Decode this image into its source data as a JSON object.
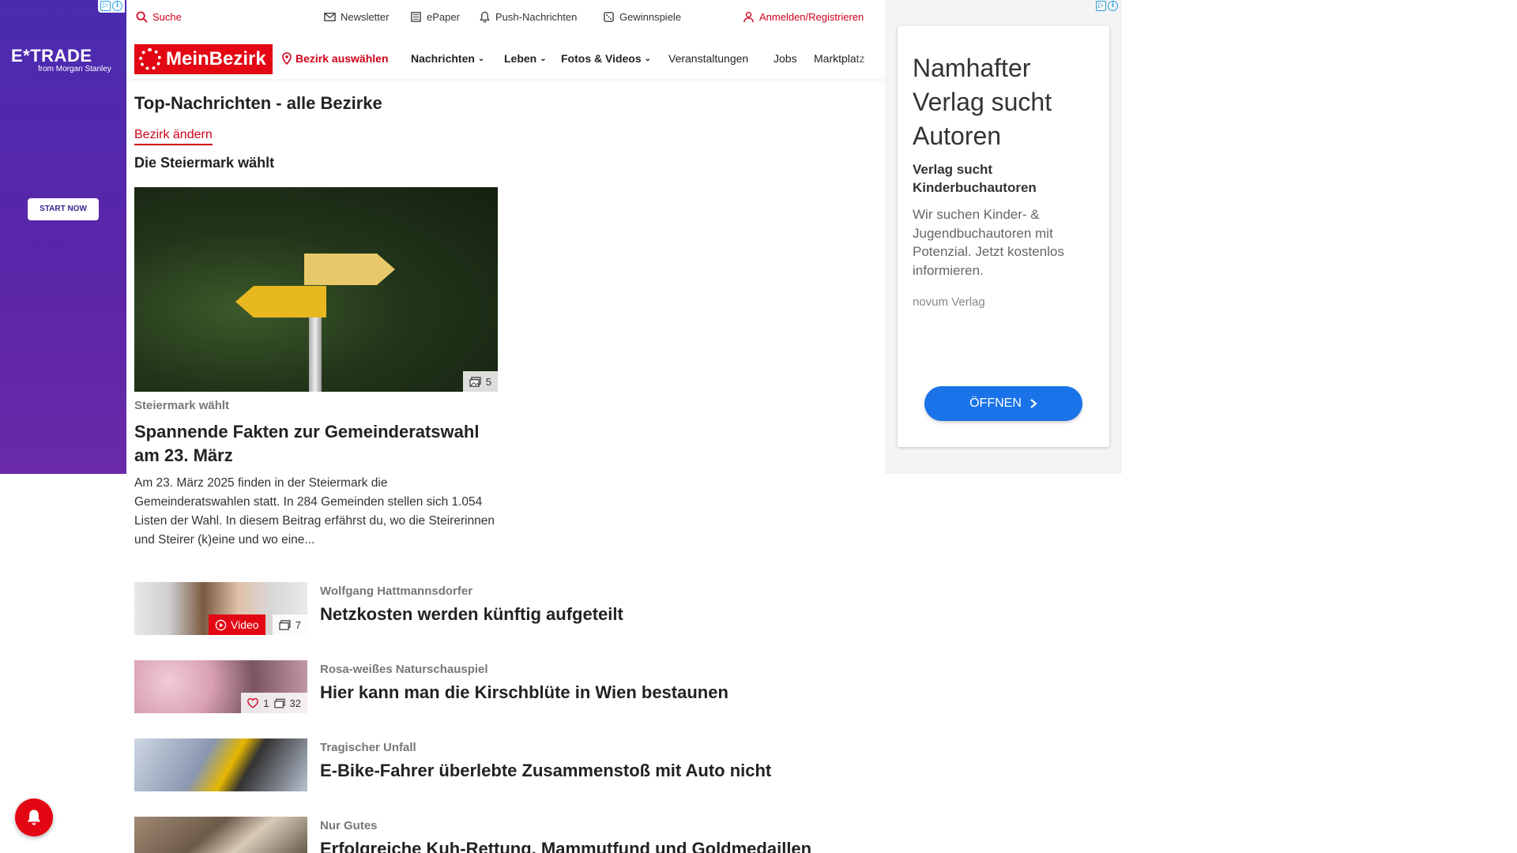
{
  "left_ad": {
    "brand": "E*TRADE",
    "brand_sub": "from Morgan Stanley",
    "cta": "START NOW",
    "colors": {
      "bg": "#4a2bb0"
    }
  },
  "utility_bar": {
    "search": "Suche",
    "newsletter": "Newsletter",
    "epaper": "ePaper",
    "push": "Push-Nachrichten",
    "contests": "Gewinnspiele",
    "login": "Anmelden/Registrieren"
  },
  "nav": {
    "logo": "MeinBezirk",
    "district_select": "Bezirk auswählen",
    "items": [
      {
        "label": "Nachrichten",
        "dropdown": true
      },
      {
        "label": "Leben",
        "dropdown": true
      },
      {
        "label": "Fotos & Videos",
        "dropdown": true
      },
      {
        "label": "Veranstaltungen",
        "dropdown": false
      },
      {
        "label": "Jobs",
        "dropdown": false
      },
      {
        "label": "Marktplatz",
        "dropdown": false
      }
    ]
  },
  "page": {
    "title": "Top-Nachrichten - alle Bezirke",
    "change_district": "Bezirk ändern",
    "section_title": "Die Steiermark wählt"
  },
  "hero": {
    "photo_count": "5",
    "kicker": "Steiermark wählt",
    "headline": "Spannende Fakten zur Gemeinderatswahl am 23. März",
    "teaser": "Am 23. März 2025 finden in der Steiermark die Gemeinderatswahlen statt. In 284 Gemeinden stellen sich 1.054 Listen der Wahl. In diesem Beitrag erfährst du, wo die Steirerinnen und Steirer (k)eine und wo eine..."
  },
  "articles": [
    {
      "kicker": "Wolfgang Hattmannsdorfer",
      "headline": "Netzkosten werden künftig aufgeteilt",
      "video_label": "Video",
      "photo_count": "7"
    },
    {
      "kicker": "Rosa-weißes Naturschauspiel",
      "headline": "Hier kann man die Kirschblüte in Wien bestaunen",
      "likes": "1",
      "photo_count": "32"
    },
    {
      "kicker": "Tragischer Unfall",
      "headline": "E-Bike-Fahrer überlebte Zusammenstoß mit Auto nicht"
    },
    {
      "kicker": "Nur Gutes",
      "headline": "Erfolgreiche Kuh-Rettung, Mammutfund und Goldmedaillen"
    }
  ],
  "right_ad": {
    "title": "Namhafter Verlag sucht Autoren",
    "subtitle": "Verlag sucht Kinderbuchautoren",
    "description": "Wir suchen Kinder- & Jugendbuchautoren mit Potenzial. Jetzt kostenlos informieren.",
    "source": "novum Verlag",
    "cta": "ÖFFNEN",
    "colors": {
      "cta": "#1a73e8"
    }
  },
  "colors": {
    "brand_red": "#e30613",
    "link_red": "#d0021b"
  }
}
